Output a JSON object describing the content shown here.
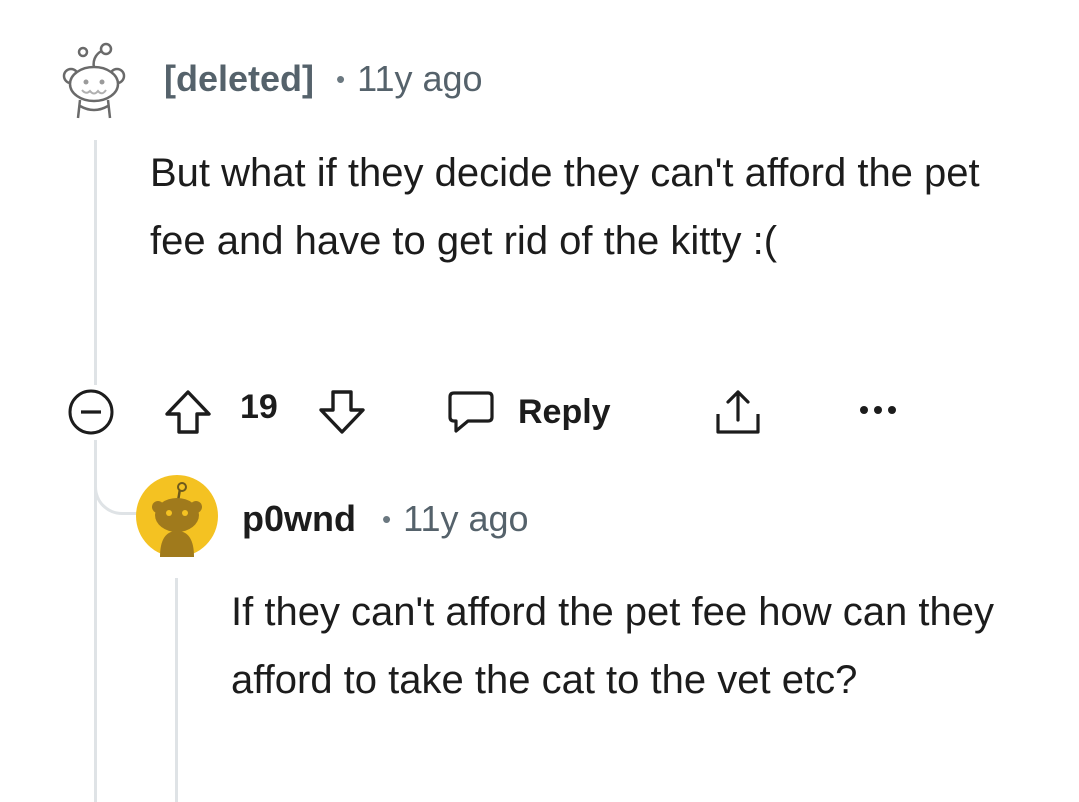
{
  "comments": [
    {
      "author": "[deleted]",
      "separator": "•",
      "time": "11y ago",
      "body": "But what if they decide they can't afford the pet fee and have to get rid of the kitty :(",
      "avatar_icon": "deleted-snoo-icon",
      "actions": {
        "collapse_icon": "collapse-minus-icon",
        "upvote_icon": "upvote-arrow-icon",
        "score": "19",
        "downvote_icon": "downvote-arrow-icon",
        "reply_icon": "reply-bubble-icon",
        "reply_label": "Reply",
        "share_icon": "share-icon",
        "more_icon": "more-dots-icon"
      }
    },
    {
      "author": "p0wnd",
      "separator": "•",
      "time": "11y ago",
      "body": "If they can't afford the pet fee how can they afford to take the cat to the vet etc?",
      "avatar_icon": "snoo-avatar-icon",
      "avatar_color": "#f4c222"
    }
  ]
}
